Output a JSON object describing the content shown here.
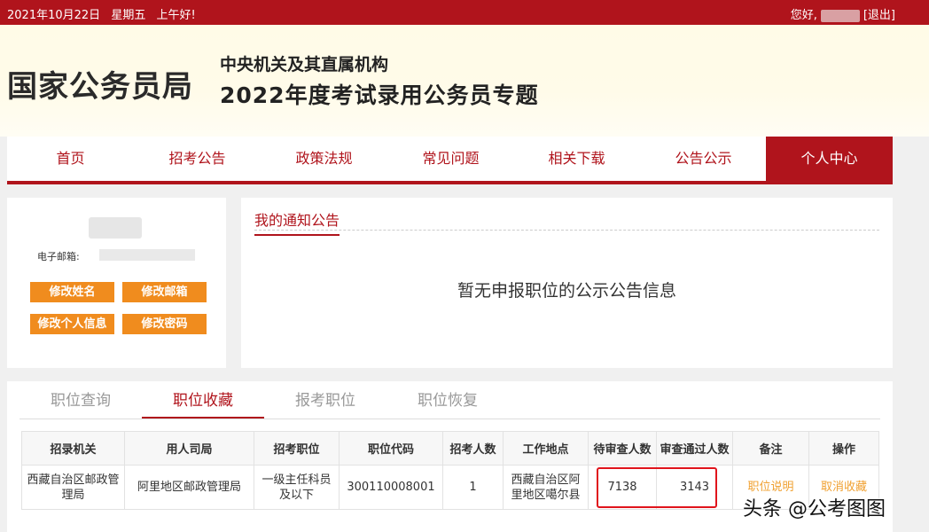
{
  "topbar": {
    "date": "2021年10月22日",
    "weekday": "星期五",
    "greeting": "上午好!",
    "hello": "您好,",
    "logout": "[退出]"
  },
  "header": {
    "logo": "国家公务员局",
    "subtitle": "中央机关及其直属机构",
    "title": "2022年度考试录用公务员专题"
  },
  "nav": [
    "首页",
    "招考公告",
    "政策法规",
    "常见问题",
    "相关下载",
    "公告公示",
    "个人中心"
  ],
  "profile": {
    "email_label": "电子邮箱:",
    "buttons": [
      "修改姓名",
      "修改邮箱",
      "修改个人信息",
      "修改密码"
    ]
  },
  "notice": {
    "title": "我的通知公告",
    "empty": "暂无申报职位的公示公告信息"
  },
  "tabs": [
    "职位查询",
    "职位收藏",
    "报考职位",
    "职位恢复"
  ],
  "table": {
    "headers": [
      "招录机关",
      "用人司局",
      "招考职位",
      "职位代码",
      "招考人数",
      "工作地点",
      "待审查人数",
      "审查通过人数",
      "备注",
      "操作"
    ],
    "row": [
      "西藏自治区邮政管理局",
      "阿里地区邮政管理局",
      "一级主任科员及以下",
      "300110008001",
      "1",
      "西藏自治区阿里地区噶尔县",
      "7138",
      "3143",
      "职位说明",
      "取消收藏"
    ]
  },
  "watermark": "头条 @公考图图",
  "colors": {
    "brand_red": "#b0141c",
    "button_orange": "#f08c1e",
    "link_orange": "#f0a030"
  }
}
